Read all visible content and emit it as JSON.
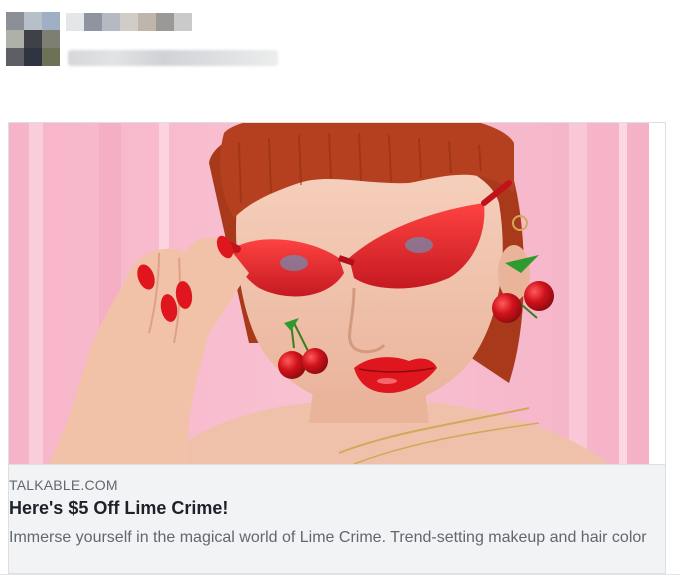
{
  "post": {
    "author_blurred": true,
    "caption_blurred": true,
    "avatar_pixels": [
      "#8c8f97",
      "#b7bfc9",
      "#9fb0c4",
      "#aeb1a8",
      "#3f4148",
      "#7c7f71",
      "#5d5f64",
      "#2f3440",
      "#6d7257"
    ],
    "name_pixels": [
      "#e4e7ea",
      "#8e95a1",
      "#b4b9c2",
      "#d0cdc9",
      "#bfb5ab",
      "#9a9998",
      "#c9cac9"
    ]
  },
  "link_card": {
    "domain": "TALKABLE.COM",
    "title": "Here's $5 Off Lime Crime!",
    "description": "Immerse yourself in the magical world of Lime Crime. Trend-setting makeup and hair color",
    "image_icon": "promo-photo-red-sunglasses-cherry-earrings",
    "colors": {
      "background_pink": "#f6b9cb",
      "hair": "#b5401f",
      "sunglasses": "#e0161f",
      "cherries": "#c8101a"
    }
  }
}
